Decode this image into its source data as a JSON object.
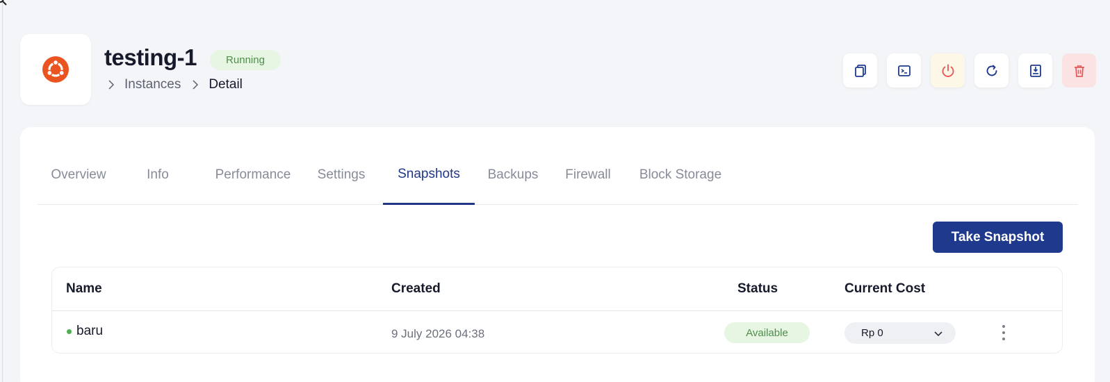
{
  "instance": {
    "name": "testing-1",
    "status": "Running",
    "os_icon": "ubuntu-icon"
  },
  "breadcrumb": {
    "items": [
      "Instances",
      "Detail"
    ]
  },
  "actions": [
    {
      "icon": "copy-icon"
    },
    {
      "icon": "console-icon"
    },
    {
      "icon": "power-icon"
    },
    {
      "icon": "restart-icon"
    },
    {
      "icon": "save-icon"
    },
    {
      "icon": "trash-icon"
    }
  ],
  "tabs": [
    {
      "label": "Overview"
    },
    {
      "label": "Info"
    },
    {
      "label": "Performance"
    },
    {
      "label": "Settings"
    },
    {
      "label": "Snapshots",
      "active": true
    },
    {
      "label": "Backups"
    },
    {
      "label": "Firewall"
    },
    {
      "label": "Block Storage"
    }
  ],
  "snapshots": {
    "take_snapshot_label": "Take Snapshot",
    "columns": {
      "name": "Name",
      "created": "Created",
      "status": "Status",
      "current_cost": "Current Cost"
    },
    "rows": [
      {
        "name": "baru",
        "created": "9 July 2026 04:38",
        "status": "Available",
        "cost": "Rp 0"
      }
    ]
  },
  "colors": {
    "primary": "#1f3a8d",
    "ubuntu_orange": "#e95420",
    "success_bg": "#e6f6e3",
    "success_text": "#4e8d4a",
    "danger": "#e45b5b",
    "power_bg": "#fdf7e7"
  }
}
